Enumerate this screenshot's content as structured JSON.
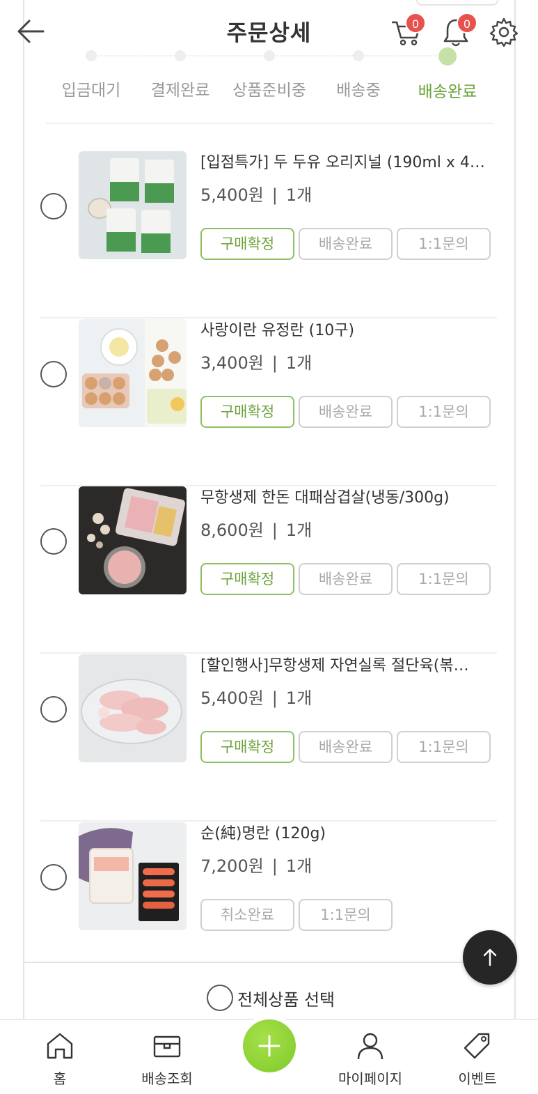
{
  "header": {
    "title": "주문상세",
    "cart_count": "0",
    "notification_count": "0"
  },
  "steps": [
    {
      "label": "입금대기",
      "active": false
    },
    {
      "label": "결제완료",
      "active": false
    },
    {
      "label": "상품준비중",
      "active": false
    },
    {
      "label": "배송중",
      "active": false
    },
    {
      "label": "배송완료",
      "active": true
    }
  ],
  "items": [
    {
      "name": "[입점특가] 두 두유 오리지널 (190ml x 4…",
      "price": "5,400원",
      "qty": "1개",
      "buttons": [
        "구매확정",
        "배송완료",
        "1:1문의"
      ]
    },
    {
      "name": "사랑이란 유정란 (10구)",
      "price": "3,400원",
      "qty": "1개",
      "buttons": [
        "구매확정",
        "배송완료",
        "1:1문의"
      ]
    },
    {
      "name": "무항생제 한돈 대패삼겹살(냉동/300g)",
      "price": "8,600원",
      "qty": "1개",
      "buttons": [
        "구매확정",
        "배송완료",
        "1:1문의"
      ]
    },
    {
      "name": "[할인행사]무항생제 자연실록 절단육(볶…",
      "price": "5,400원",
      "qty": "1개",
      "buttons": [
        "구매확정",
        "배송완료",
        "1:1문의"
      ]
    },
    {
      "name": "순(純)명란 (120g)",
      "price": "7,200원",
      "qty": "1개",
      "buttons": [
        "취소완료",
        "1:1문의"
      ]
    }
  ],
  "select_all_label": "전체상품 선택",
  "nav": {
    "home": "홈",
    "delivery": "배송조회",
    "mypage": "마이페이지",
    "event": "이벤트"
  },
  "colors": {
    "accent_green": "#6ba339",
    "badge_red": "#e8524d",
    "fab_green": "#8ed136"
  }
}
